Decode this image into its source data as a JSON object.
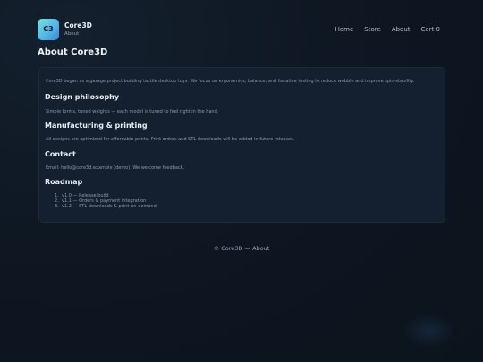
{
  "brand": {
    "logo_text": "C3",
    "name": "Core3D",
    "subtitle": "About"
  },
  "nav": {
    "items": [
      {
        "label": "Home"
      },
      {
        "label": "Store"
      },
      {
        "label": "About"
      },
      {
        "label": "Cart 0"
      }
    ]
  },
  "page": {
    "title": "About Core3D"
  },
  "content": {
    "intro": "Core3D began as a garage project building tactile desktop toys. We focus on ergonomics, balance, and iterative testing to reduce wobble and improve spin-stability.",
    "design": {
      "heading": "Design philosophy",
      "text": "Simple forms, tuned weights — each model is tuned to feel right in the hand."
    },
    "manufacturing": {
      "heading": "Manufacturing & printing",
      "text": "All designs are optimized for affordable prints. Print orders and STL downloads will be added in future releases."
    },
    "contact": {
      "heading": "Contact",
      "text": "Email: hello@core3d.example (demo). We welcome feedback."
    },
    "roadmap": {
      "heading": "Roadmap",
      "items": [
        {
          "num": "1.",
          "text": "v1.0 — Release build"
        },
        {
          "num": "2.",
          "text": "v1.1 — Orders & payment integration"
        },
        {
          "num": "3.",
          "text": "v1.2 — STL downloads & print-on-demand"
        }
      ]
    }
  },
  "footer": {
    "text": "© Core3D — About"
  },
  "colors": {
    "background": "#0e1722",
    "card": "#142030",
    "accent_start": "#7ee0d6",
    "accent_end": "#3a88d8"
  }
}
